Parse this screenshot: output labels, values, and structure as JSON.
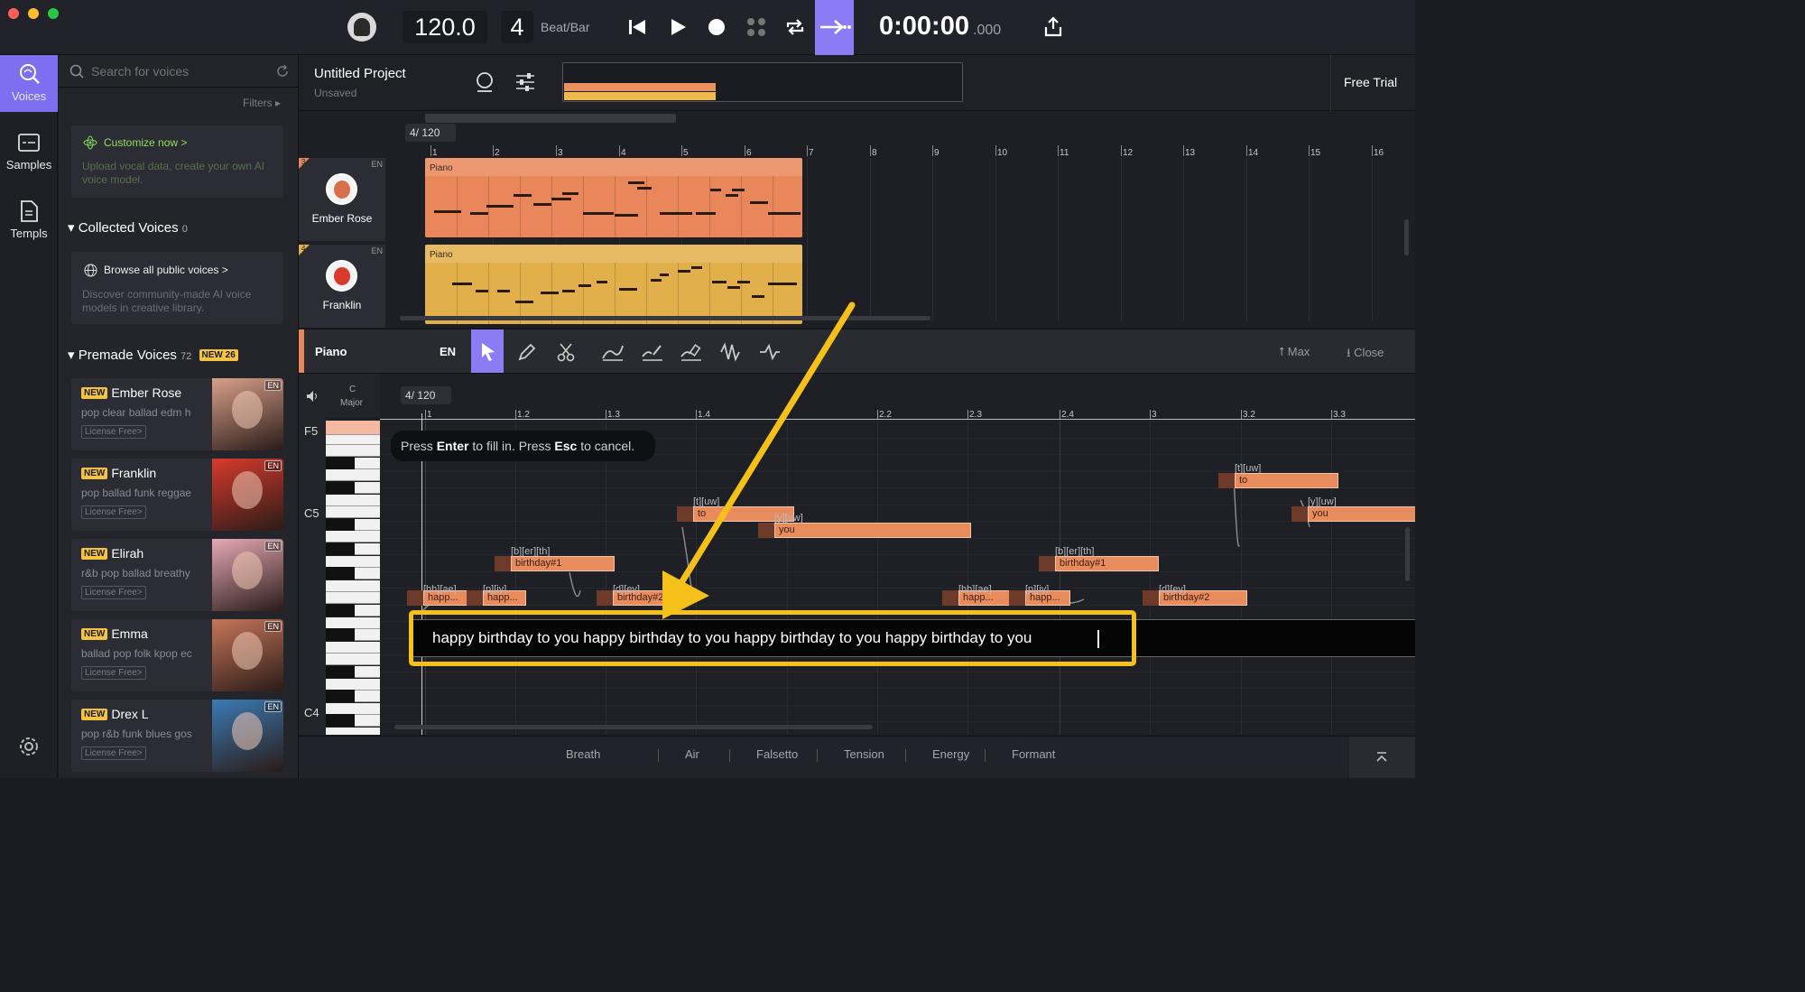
{
  "topbar": {
    "tempo": "120.0",
    "beats": "4",
    "beat_unit": "Beat/Bar",
    "time_main": "0:00:00",
    "time_ms": ".000"
  },
  "rail": [
    {
      "label": "Voices",
      "icon": "voices-icon"
    },
    {
      "label": "Samples",
      "icon": "samples-icon"
    },
    {
      "label": "Templs",
      "icon": "templates-icon"
    }
  ],
  "panel": {
    "search_placeholder": "Search for voices",
    "filters": "Filters",
    "customize_title": "Customize now >",
    "customize_desc": "Upload vocal data, create your own AI voice model.",
    "collected_title": "Collected Voices",
    "collected_count": "0",
    "browse_title": "Browse all public voices >",
    "browse_desc": "Discover community-made AI voice models in creative library.",
    "premade_title": "Premade Voices",
    "premade_count": "72",
    "premade_new": "NEW 26",
    "new_badge": "NEW",
    "license": "License Free>",
    "lang": "EN",
    "voices": [
      {
        "name": "Ember Rose",
        "tags": "pop clear ballad edm h",
        "color": "#d9a08a"
      },
      {
        "name": "Franklin",
        "tags": "pop ballad funk reggae",
        "color": "#d83a2c"
      },
      {
        "name": "Elirah",
        "tags": "r&b pop ballad breathy",
        "color": "#e7aab4"
      },
      {
        "name": "Emma",
        "tags": "ballad pop folk kpop ec",
        "color": "#c7765a"
      },
      {
        "name": "Drex L",
        "tags": "pop r&b funk blues gos",
        "color": "#3a7bb5"
      }
    ]
  },
  "project": {
    "title": "Untitled Project",
    "status": "Unsaved",
    "free_trial": "Free Trial"
  },
  "arrangement": {
    "time_sig": "4/",
    "tempo": "120",
    "bars": [
      "1",
      "2",
      "3",
      "4",
      "5",
      "6",
      "7",
      "8",
      "9",
      "10",
      "11",
      "12",
      "13",
      "14",
      "15",
      "16"
    ],
    "tracks": [
      {
        "name": "Ember Rose",
        "num": "3",
        "lang": "EN",
        "clip": "Piano",
        "color": "#e9875a"
      },
      {
        "name": "Franklin",
        "num": "4",
        "lang": "EN",
        "clip": "Piano",
        "color": "#e2b04a"
      }
    ]
  },
  "toolbar": {
    "track": "Piano",
    "lang": "EN",
    "max": "Max",
    "close": "Close"
  },
  "roll": {
    "key_top": "C",
    "key_bottom": "Major",
    "time_sig": "4/",
    "tempo": "120",
    "ticks": [
      "1",
      "1.2",
      "1.3",
      "1.4",
      "2.2",
      "2.3",
      "2.4",
      "3",
      "3.2",
      "3.3"
    ],
    "octaves": [
      "F5",
      "C5",
      "C4"
    ],
    "hint_pre": "Press ",
    "hint_enter": "Enter",
    "hint_mid": " to fill in. Press ",
    "hint_esc": "Esc",
    "hint_post": " to cancel.",
    "lyrics_input": "happy birthday to you happy birthday to you happy birthday to you happy birthday to you",
    "notes": [
      {
        "text": "happ...",
        "phon": "[hh][ae]"
      },
      {
        "text": "happ...",
        "phon": "[p][iy]"
      },
      {
        "text": "birthday#1",
        "phon": "[b][er][th]"
      },
      {
        "text": "birthday#2",
        "phon": "[d][ey]"
      },
      {
        "text": "to",
        "phon": "[t][uw]"
      },
      {
        "text": "you",
        "phon": "[y][uw]"
      },
      {
        "text": "happ...",
        "phon": "[hh][ae]"
      },
      {
        "text": "happ...",
        "phon": "[p][iy]"
      },
      {
        "text": "birthday#1",
        "phon": "[b][er][th]"
      },
      {
        "text": "birthday#2",
        "phon": "[d][ey]"
      },
      {
        "text": "to",
        "phon": "[t][uw]"
      },
      {
        "text": "you",
        "phon": "[y][uw]"
      }
    ]
  },
  "params": [
    "Breath",
    "Air",
    "Falsetto",
    "Tension",
    "Energy",
    "Formant"
  ],
  "colors": {
    "accent": "#8b7cf6",
    "highlight": "#f5c019",
    "note": "#e98c5d"
  }
}
